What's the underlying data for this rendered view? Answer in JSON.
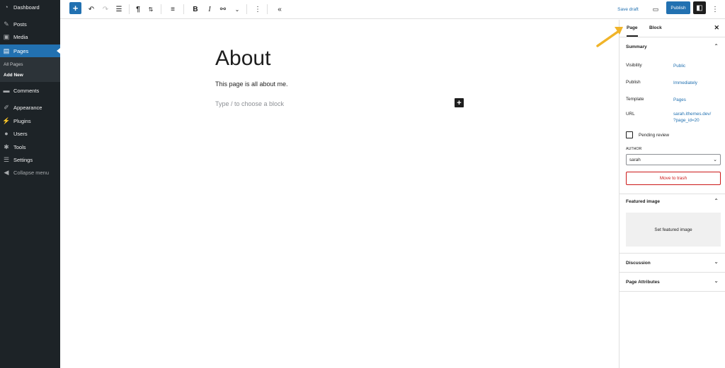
{
  "admin_menu": {
    "items": [
      {
        "label": "Dashboard",
        "icon": "dashboard-icon"
      },
      {
        "label": "Posts",
        "icon": "pin-icon"
      },
      {
        "label": "Media",
        "icon": "media-icon"
      },
      {
        "label": "Pages",
        "icon": "pages-icon"
      },
      {
        "label": "Comments",
        "icon": "comments-icon"
      },
      {
        "label": "Appearance",
        "icon": "brush-icon"
      },
      {
        "label": "Plugins",
        "icon": "plug-icon"
      },
      {
        "label": "Users",
        "icon": "users-icon"
      },
      {
        "label": "Tools",
        "icon": "wrench-icon"
      },
      {
        "label": "Settings",
        "icon": "settings-icon"
      },
      {
        "label": "Collapse menu",
        "icon": "collapse-icon"
      }
    ],
    "submenu": [
      "All Pages",
      "Add New"
    ],
    "accent": "#2271b1"
  },
  "toolbar": {
    "save_draft": "Save draft",
    "publish": "Publish"
  },
  "editor": {
    "title": "About",
    "paragraph": "This page is all about me.",
    "placeholder": "Type / to choose a block"
  },
  "sidebar": {
    "tabs": [
      "Page",
      "Block"
    ],
    "summary": {
      "heading": "Summary",
      "visibility_label": "Visibility",
      "visibility_value": "Public",
      "publish_label": "Publish",
      "publish_value": "Immediately",
      "template_label": "Template",
      "template_value": "Pages",
      "url_label": "URL",
      "url_value_line1": "sarah.ithemes.dev/",
      "url_value_line2": "?page_id=20",
      "pending_review": "Pending review",
      "author_label": "AUTHOR",
      "author_value": "sarah",
      "move_to_trash": "Move to trash"
    },
    "featured_image": {
      "heading": "Featured image",
      "button": "Set featured image"
    },
    "discussion": "Discussion",
    "page_attributes": "Page Attributes"
  }
}
